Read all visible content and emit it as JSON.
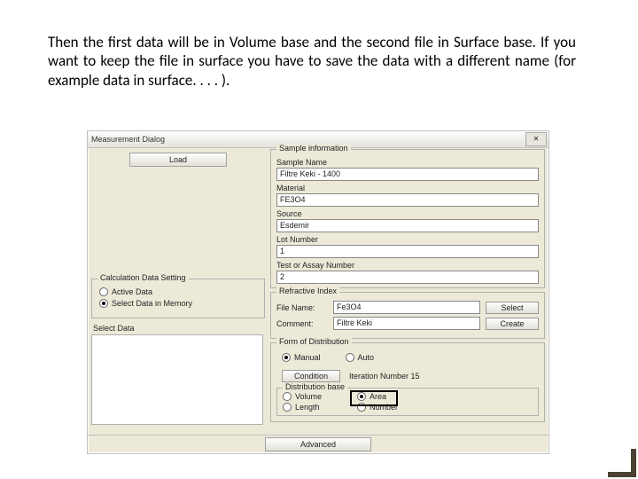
{
  "caption": "Then the first data will be in Volume base and the second file in Surface base. If you want to keep the file in surface you have to save the data with a different name (for example data in surface. . . . ).",
  "dialog": {
    "title": "Measurement Dialog",
    "close": "✕",
    "load_button": "Load",
    "calc_setting": {
      "legend": "Calculation Data Setting",
      "active": "Active Data",
      "select_mem": "Select Data in Memory"
    },
    "select_data_label": "Select Data",
    "sample_info": {
      "legend": "Sample information",
      "sample_name_label": "Sample Name",
      "sample_name_value": "Filtre Keki - 1400",
      "material_label": "Material",
      "material_value": "FE3O4",
      "source_label": "Source",
      "source_value": "Esdemir",
      "lot_label": "Lot Number",
      "lot_value": "1",
      "assay_label": "Test or Assay Number",
      "assay_value": "2"
    },
    "refractive": {
      "legend": "Refractive Index",
      "file_name_label": "File Name:",
      "file_name_value": "Fe3O4",
      "comment_label": "Comment:",
      "comment_value": "Filtre Keki",
      "select_btn": "Select",
      "create_btn": "Create"
    },
    "fod": {
      "legend": "Form of Distribution",
      "manual": "Manual",
      "auto": "Auto",
      "condition_btn": "Condition",
      "iter_label": "Iteration Number 15"
    },
    "dist_base": {
      "legend": "Distribution base",
      "volume": "Volume",
      "area": "Area",
      "length": "Length",
      "number": "Number"
    },
    "advanced_btn": "Advanced"
  }
}
